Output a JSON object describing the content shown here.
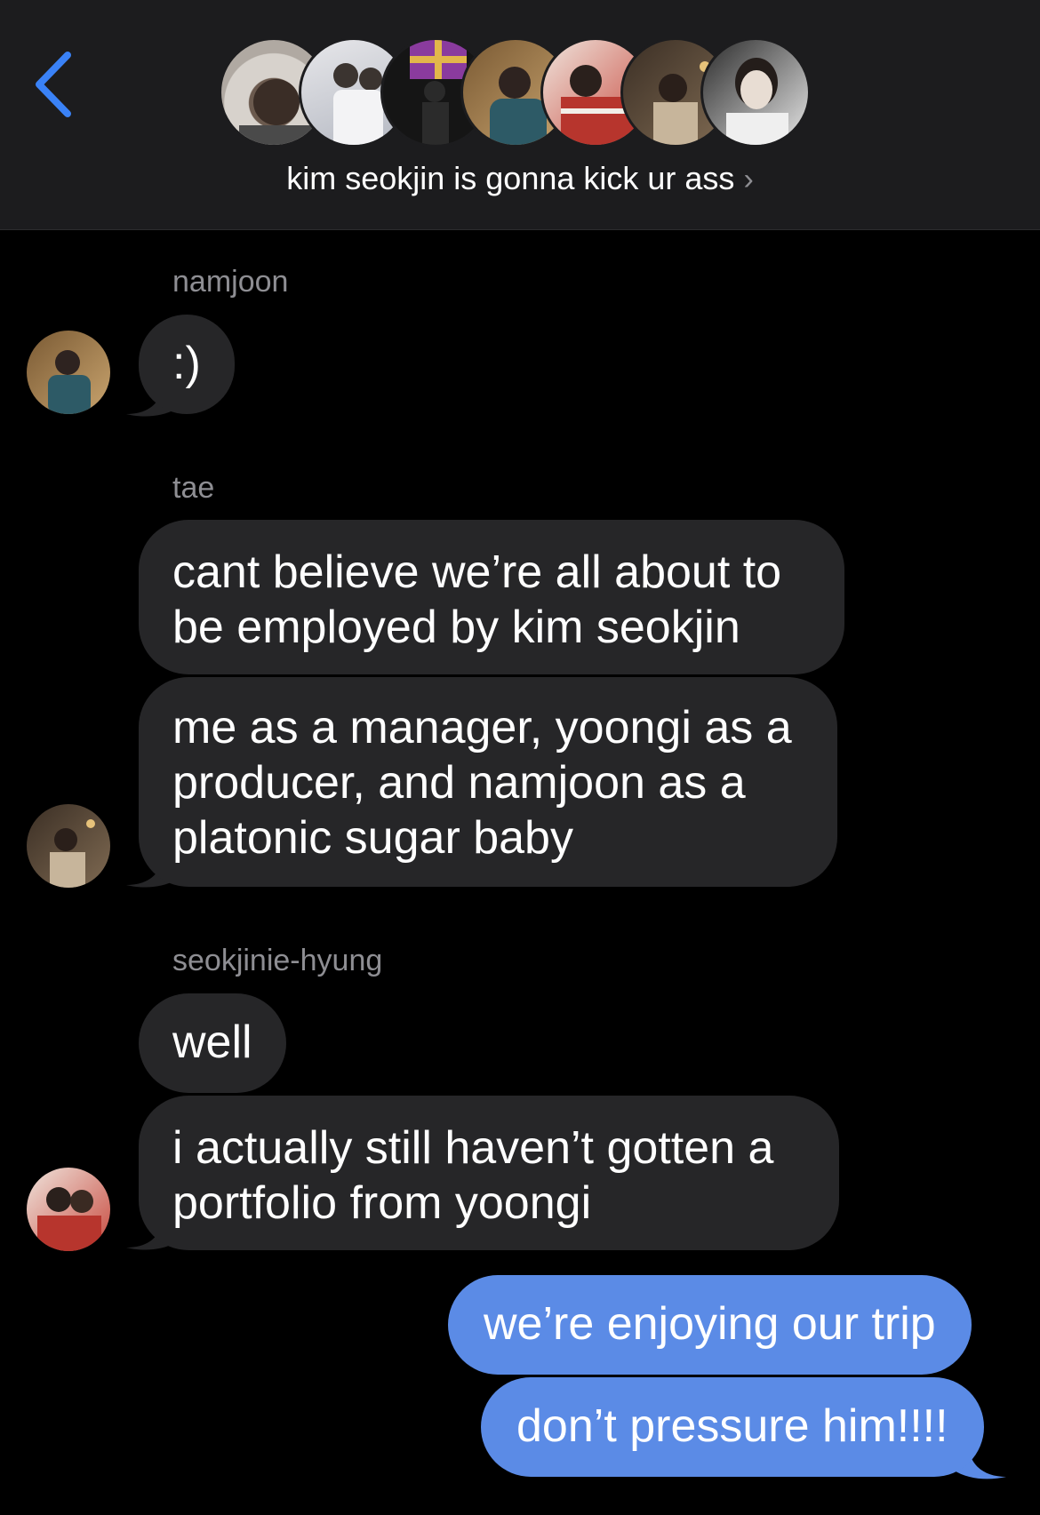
{
  "header": {
    "back_icon": "chevron-left-icon",
    "title": "kim seokjin is gonna kick ur ass",
    "title_chevron": "›",
    "member_avatar_count": 7,
    "accent_color": "#3a82f7"
  },
  "conversation": {
    "groups": [
      {
        "sender": "namjoon",
        "messages": [
          ":)"
        ]
      },
      {
        "sender": "tae",
        "messages": [
          "cant believe we’re all about to be employed by kim seokjin",
          "me as a manager, yoongi as a producer, and namjoon as a platonic sugar baby"
        ]
      },
      {
        "sender": "seokjinie-hyung",
        "messages": [
          "well",
          "i actually still haven’t gotten a portfolio from yoongi"
        ]
      }
    ],
    "outgoing": [
      "we’re enjoying our trip",
      "don’t pressure him!!!!"
    ]
  },
  "colors": {
    "background": "#000000",
    "header_bg": "#1c1c1e",
    "incoming_bubble": "#262628",
    "outgoing_bubble": "#5b8be6",
    "sender_label": "#8e8e93"
  }
}
